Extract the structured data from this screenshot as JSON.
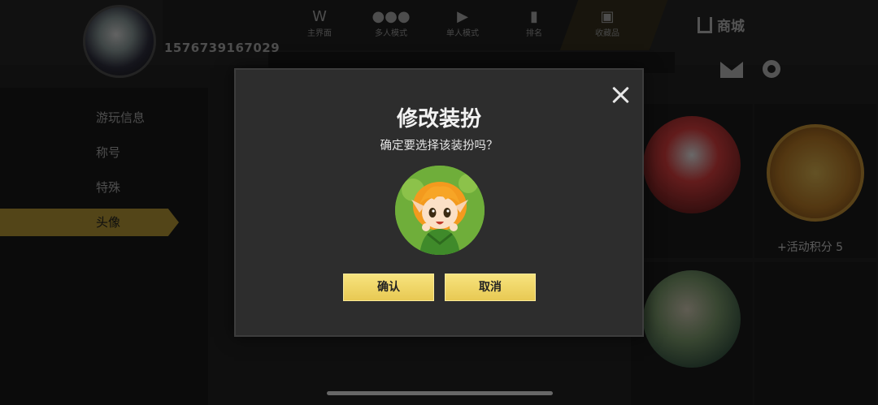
{
  "header": {
    "player_id": "1576739167029",
    "nav": [
      {
        "label": "主界面",
        "icon": "w-logo-icon"
      },
      {
        "label": "多人模式",
        "icon": "group-icon"
      },
      {
        "label": "单人模式",
        "icon": "play-icon"
      },
      {
        "label": "排名",
        "icon": "ranking-icon"
      },
      {
        "label": "收藏品",
        "icon": "collection-icon"
      }
    ],
    "shop_label": "商城"
  },
  "sidebar": {
    "items": [
      {
        "label": "游玩信息"
      },
      {
        "label": "称号"
      },
      {
        "label": "特殊"
      },
      {
        "label": "头像",
        "active": true
      }
    ]
  },
  "grid": {
    "reward_label": "+活动积分 5"
  },
  "modal": {
    "title": "修改装扮",
    "message": "确定要选择该装扮吗？",
    "preview_icon": "elf-girl-avatar",
    "confirm_label": "确认",
    "cancel_label": "取消"
  },
  "colors": {
    "button": "#f2d86a",
    "modal_bg": "#2d2d2d",
    "accent": "#c9a93a"
  }
}
